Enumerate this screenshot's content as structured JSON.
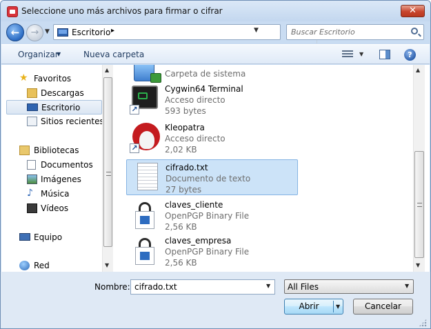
{
  "window": {
    "title": "Seleccione uno más archivos para firmar o cifrar",
    "close_label": "✕"
  },
  "address": {
    "location": "Escritorio",
    "separator": "▸"
  },
  "search": {
    "placeholder": "Buscar Escritorio"
  },
  "toolbar": {
    "organize_label": "Organizar",
    "new_folder_label": "Nueva carpeta"
  },
  "nav": {
    "items": [
      {
        "label": "Favoritos",
        "icon": "star-icon"
      },
      {
        "label": "Descargas",
        "icon": "downloads-folder-icon"
      },
      {
        "label": "Escritorio",
        "icon": "desktop-icon",
        "selected": true
      },
      {
        "label": "Sitios recientes",
        "icon": "recent-places-icon"
      },
      {
        "label": "Bibliotecas",
        "icon": "libraries-icon"
      },
      {
        "label": "Documentos",
        "icon": "documents-icon"
      },
      {
        "label": "Imágenes",
        "icon": "pictures-icon"
      },
      {
        "label": "Música",
        "icon": "music-icon"
      },
      {
        "label": "Vídeos",
        "icon": "videos-icon"
      },
      {
        "label": "Equipo",
        "icon": "computer-icon"
      },
      {
        "label": "Red",
        "icon": "network-icon"
      }
    ]
  },
  "files": [
    {
      "name": "",
      "type": "Carpeta de sistema",
      "size": "",
      "icon": "system-folder-icon"
    },
    {
      "name": "Cygwin64 Terminal",
      "type": "Acceso directo",
      "size": "593 bytes",
      "icon": "terminal-shortcut-icon"
    },
    {
      "name": "Kleopatra",
      "type": "Acceso directo",
      "size": "2,02 KB",
      "icon": "kleopatra-shortcut-icon"
    },
    {
      "name": "cifrado.txt",
      "type": "Documento de texto",
      "size": "27 bytes",
      "icon": "text-document-icon",
      "selected": true
    },
    {
      "name": "claves_cliente",
      "type": "OpenPGP Binary File",
      "size": "2,56 KB",
      "icon": "locked-file-icon"
    },
    {
      "name": "claves_empresa",
      "type": "OpenPGP Binary File",
      "size": "2,56 KB",
      "icon": "locked-file-icon"
    }
  ],
  "bottom": {
    "name_label": "Nombre:",
    "file_name_value": "cifrado.txt",
    "filter_value": "All Files",
    "open_label": "Abrir",
    "cancel_label": "Cancelar"
  },
  "colors": {
    "accent": "#2b6cc4",
    "selection": "#cce3f8",
    "chrome": "#dfe9f5"
  }
}
